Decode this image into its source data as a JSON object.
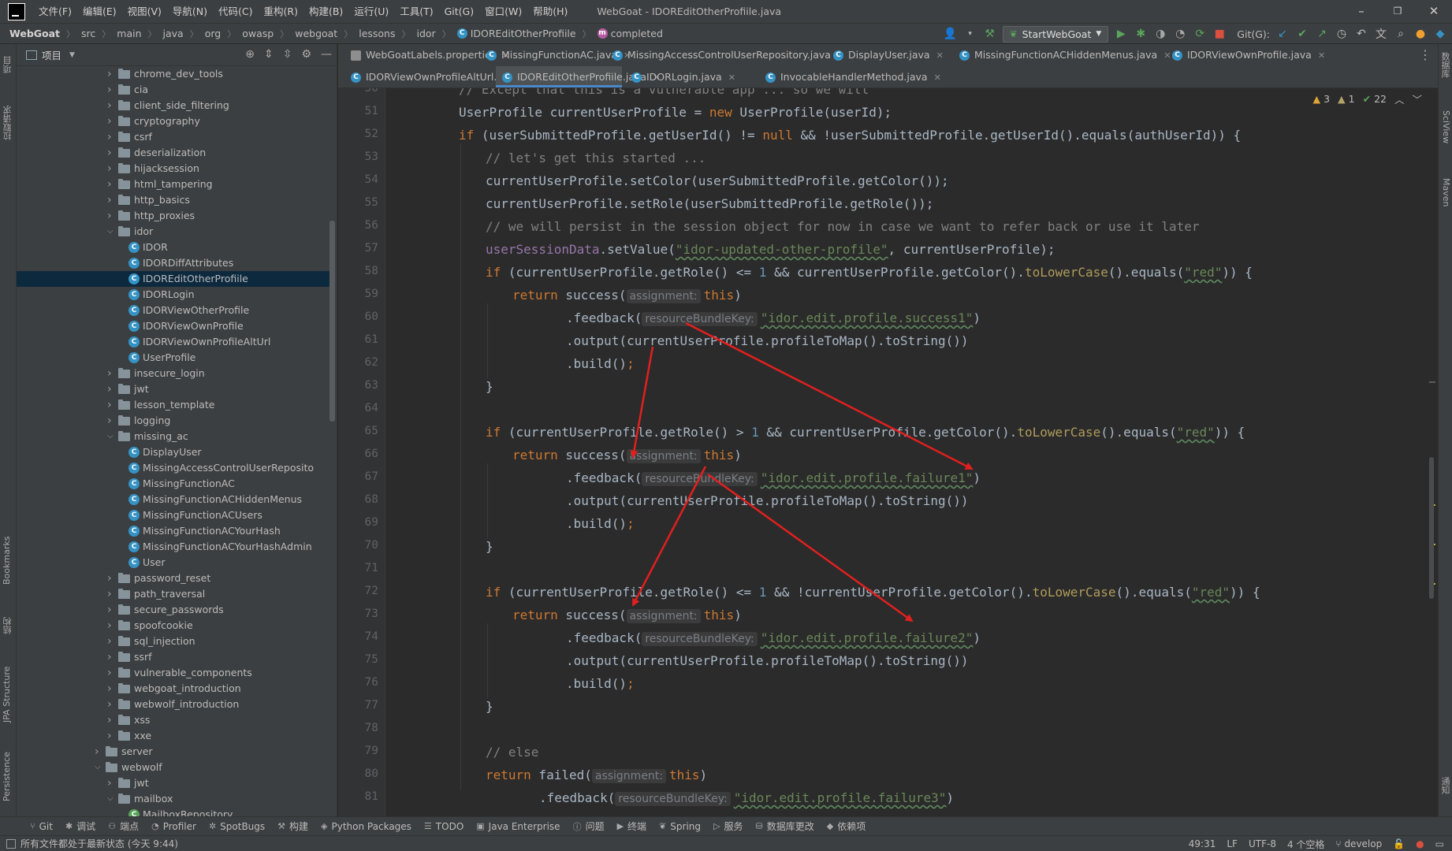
{
  "menubar": {
    "items": [
      "文件(F)",
      "编辑(E)",
      "视图(V)",
      "导航(N)",
      "代码(C)",
      "重构(R)",
      "构建(B)",
      "运行(U)",
      "工具(T)",
      "Git(G)",
      "窗口(W)",
      "帮助(H)"
    ],
    "window_title": "WebGoat - IDOREditOtherProfiile.java",
    "minimize": "–",
    "restore": "❐",
    "close": "✕"
  },
  "navbar": {
    "breadcrumbs": [
      "WebGoat",
      "src",
      "main",
      "java",
      "org",
      "owasp",
      "webgoat",
      "lessons",
      "idor",
      "IDOREditOtherProfiile",
      "completed"
    ],
    "run_config": "StartWebGoat",
    "git_label": "Git(G):"
  },
  "left_stripe": {
    "project": "项目",
    "pull_requests": "拉取请求",
    "bookmarks": "Bookmarks",
    "structure": "结构",
    "jpa": "JPA Structure",
    "persistence": "Persistence"
  },
  "right_stripe": {
    "database": "数据库",
    "sciview": "SciView",
    "maven": "Maven",
    "notifications": "通知"
  },
  "project_panel": {
    "title": "项目",
    "tree": [
      {
        "label": "chrome_dev_tools",
        "type": "folder",
        "depth": 0,
        "expanded": false
      },
      {
        "label": "cia",
        "type": "folder",
        "depth": 0,
        "expanded": false
      },
      {
        "label": "client_side_filtering",
        "type": "folder",
        "depth": 0,
        "expanded": false
      },
      {
        "label": "cryptography",
        "type": "folder",
        "depth": 0,
        "expanded": false
      },
      {
        "label": "csrf",
        "type": "folder",
        "depth": 0,
        "expanded": false
      },
      {
        "label": "deserialization",
        "type": "folder",
        "depth": 0,
        "expanded": false
      },
      {
        "label": "hijacksession",
        "type": "folder",
        "depth": 0,
        "expanded": false
      },
      {
        "label": "html_tampering",
        "type": "folder",
        "depth": 0,
        "expanded": false
      },
      {
        "label": "http_basics",
        "type": "folder",
        "depth": 0,
        "expanded": false
      },
      {
        "label": "http_proxies",
        "type": "folder",
        "depth": 0,
        "expanded": false
      },
      {
        "label": "idor",
        "type": "folder",
        "depth": 0,
        "expanded": true
      },
      {
        "label": "IDOR",
        "type": "class",
        "depth": 1
      },
      {
        "label": "IDORDiffAttributes",
        "type": "class",
        "depth": 1
      },
      {
        "label": "IDOREditOtherProfiile",
        "type": "class",
        "depth": 1,
        "selected": true
      },
      {
        "label": "IDORLogin",
        "type": "class",
        "depth": 1
      },
      {
        "label": "IDORViewOtherProfile",
        "type": "class",
        "depth": 1
      },
      {
        "label": "IDORViewOwnProfile",
        "type": "class",
        "depth": 1
      },
      {
        "label": "IDORViewOwnProfileAltUrl",
        "type": "class",
        "depth": 1
      },
      {
        "label": "UserProfile",
        "type": "class",
        "depth": 1
      },
      {
        "label": "insecure_login",
        "type": "folder",
        "depth": 0,
        "expanded": false
      },
      {
        "label": "jwt",
        "type": "folder",
        "depth": 0,
        "expanded": false
      },
      {
        "label": "lesson_template",
        "type": "folder",
        "depth": 0,
        "expanded": false
      },
      {
        "label": "logging",
        "type": "folder",
        "depth": 0,
        "expanded": false
      },
      {
        "label": "missing_ac",
        "type": "folder",
        "depth": 0,
        "expanded": true
      },
      {
        "label": "DisplayUser",
        "type": "class",
        "depth": 1
      },
      {
        "label": "MissingAccessControlUserReposito",
        "type": "class",
        "depth": 1
      },
      {
        "label": "MissingFunctionAC",
        "type": "class",
        "depth": 1
      },
      {
        "label": "MissingFunctionACHiddenMenus",
        "type": "class",
        "depth": 1
      },
      {
        "label": "MissingFunctionACUsers",
        "type": "class",
        "depth": 1
      },
      {
        "label": "MissingFunctionACYourHash",
        "type": "class",
        "depth": 1
      },
      {
        "label": "MissingFunctionACYourHashAdmin",
        "type": "class",
        "depth": 1
      },
      {
        "label": "User",
        "type": "class",
        "depth": 1
      },
      {
        "label": "password_reset",
        "type": "folder",
        "depth": 0,
        "expanded": false
      },
      {
        "label": "path_traversal",
        "type": "folder",
        "depth": 0,
        "expanded": false
      },
      {
        "label": "secure_passwords",
        "type": "folder",
        "depth": 0,
        "expanded": false
      },
      {
        "label": "spoofcookie",
        "type": "folder",
        "depth": 0,
        "expanded": false
      },
      {
        "label": "sql_injection",
        "type": "folder",
        "depth": 0,
        "expanded": false
      },
      {
        "label": "ssrf",
        "type": "folder",
        "depth": 0,
        "expanded": false
      },
      {
        "label": "vulnerable_components",
        "type": "folder",
        "depth": 0,
        "expanded": false
      },
      {
        "label": "webgoat_introduction",
        "type": "folder",
        "depth": 0,
        "expanded": false
      },
      {
        "label": "webwolf_introduction",
        "type": "folder",
        "depth": 0,
        "expanded": false
      },
      {
        "label": "xss",
        "type": "folder",
        "depth": 0,
        "expanded": false
      },
      {
        "label": "xxe",
        "type": "folder",
        "depth": 0,
        "expanded": false
      },
      {
        "label": "server",
        "type": "folder",
        "depth": -1,
        "expanded": false
      },
      {
        "label": "webwolf",
        "type": "folder",
        "depth": -1,
        "expanded": true
      },
      {
        "label": "jwt",
        "type": "folder",
        "depth": 0,
        "expanded": false
      },
      {
        "label": "mailbox",
        "type": "folder",
        "depth": 0,
        "expanded": true
      },
      {
        "label": "MailboxRepository",
        "type": "class-green",
        "depth": 1
      }
    ]
  },
  "tabs": {
    "row1": [
      {
        "label": "WebGoatLabels.properties",
        "icon": "props"
      },
      {
        "label": "MissingFunctionAC.java",
        "icon": "class"
      },
      {
        "label": "MissingAccessControlUserRepository.java",
        "icon": "class"
      },
      {
        "label": "DisplayUser.java",
        "icon": "class"
      },
      {
        "label": "MissingFunctionACHiddenMenus.java",
        "icon": "class"
      },
      {
        "label": "IDORViewOwnProfile.java",
        "icon": "class"
      }
    ],
    "row2": [
      {
        "label": "IDORViewOwnProfileAltUrl.java",
        "icon": "class"
      },
      {
        "label": "IDOREditOtherProfiile.java",
        "icon": "class",
        "active": true
      },
      {
        "label": "IDORLogin.java",
        "icon": "class"
      },
      {
        "label": "InvocableHandlerMethod.java",
        "icon": "class"
      }
    ]
  },
  "editor": {
    "inspections": {
      "warnings": "3",
      "weak_warnings": "1",
      "ok": "22"
    },
    "line_numbers": [
      "50",
      "51",
      "52",
      "53",
      "54",
      "55",
      "56",
      "57",
      "58",
      "59",
      "60",
      "61",
      "62",
      "63",
      "64",
      "65",
      "66",
      "67",
      "68",
      "69",
      "70",
      "71",
      "72",
      "73",
      "74",
      "75",
      "76",
      "77",
      "78",
      "79",
      "80",
      "81"
    ],
    "code": {
      "l50": "// Except that this is a vulnerable app ... so we will",
      "l51_a": "UserProfile currentUserProfile = ",
      "l51_kw": "new",
      "l51_b": " UserProfile(userId);",
      "l52_kw1": "if",
      "l52_a": " (userSubmittedProfile.getUserId() != ",
      "l52_kw2": "null",
      "l52_b": " && !userSubmittedProfile.getUserId().equals(authUserId)) {",
      "l53": "// let's get this started ...",
      "l54": "currentUserProfile.setColor(userSubmittedProfile.getColor());",
      "l55": "currentUserProfile.setRole(userSubmittedProfile.getRole());",
      "l56": "// we will persist in the session object for now in case we want to refer back or use it later",
      "l57_fld": "userSessionData",
      "l57_a": ".setValue(",
      "l57_str": "\"idor-updated-other-profile\"",
      "l57_b": ", currentUserProfile);",
      "l58_kw": "if",
      "l58_a": " (currentUserProfile.getRole() <= ",
      "l58_num": "1",
      "l58_b": " && currentUserProfile.getColor().",
      "l58_dep": "toLowerCase",
      "l58_c": "().equals(",
      "l58_str": "\"red\"",
      "l58_d": ")) {",
      "return_kw": "return",
      "success_call": " success(",
      "hint_assignment": "assignment:",
      "this_kw": "this",
      "close_paren": ")",
      "feedback_call": ".feedback(",
      "hint_rbk": "resourceBundleKey:",
      "l60_str": "\"idor.edit.profile.success1\"",
      "output_line": ".output(currentUserProfile.profileToMap().toString())",
      "build_call": ".build()",
      "semicolon": ";",
      "close_brace": "}",
      "l65_kw": "if",
      "l65_a": " (currentUserProfile.getRole() > ",
      "l65_num": "1",
      "l65_b": " && currentUserProfile.getColor().",
      "l65_dep": "toLowerCase",
      "l65_c": "().equals(",
      "l65_str": "\"red\"",
      "l65_d": ")) {",
      "l67_str": "\"idor.edit.profile.failure1\"",
      "l72_kw": "if",
      "l72_a": " (currentUserProfile.getRole() <= ",
      "l72_num": "1",
      "l72_b": " && !currentUserProfile.getColor().",
      "l72_dep": "toLowerCase",
      "l72_c": "().equals(",
      "l72_str": "\"red\"",
      "l72_d": ")) {",
      "l74_str": "\"idor.edit.profile.failure2\"",
      "l79": "// else",
      "failed_call": " failed(",
      "l81_str": "\"idor.edit.profile.failure3\""
    }
  },
  "bottom_tools": [
    {
      "label": "Git",
      "icon": "⑂"
    },
    {
      "label": "调试",
      "icon": "✱"
    },
    {
      "label": "端点",
      "icon": "⚇"
    },
    {
      "label": "Profiler",
      "icon": "◔"
    },
    {
      "label": "SpotBugs",
      "icon": "✲"
    },
    {
      "label": "构建",
      "icon": "⚒"
    },
    {
      "label": "Python Packages",
      "icon": "◈"
    },
    {
      "label": "TODO",
      "icon": "☰"
    },
    {
      "label": "Java Enterprise",
      "icon": "▣"
    },
    {
      "label": "问题",
      "icon": "ⓘ"
    },
    {
      "label": "终端",
      "icon": "▶"
    },
    {
      "label": "Spring",
      "icon": "❦"
    },
    {
      "label": "服务",
      "icon": "▷"
    },
    {
      "label": "数据库更改",
      "icon": "⛁"
    },
    {
      "label": "依赖项",
      "icon": "◆"
    }
  ],
  "status_bar": {
    "message": "所有文件都处于最新状态 (今天 9:44)",
    "position": "49:31",
    "line_sep": "LF",
    "encoding": "UTF-8",
    "indent": "4 个空格",
    "branch": "develop"
  },
  "colors": {
    "keyword": "#cc7832",
    "string": "#6a8759",
    "comment": "#808080",
    "field": "#9876aa",
    "number": "#6897bb",
    "annotation_arrow": "#e0201f"
  }
}
